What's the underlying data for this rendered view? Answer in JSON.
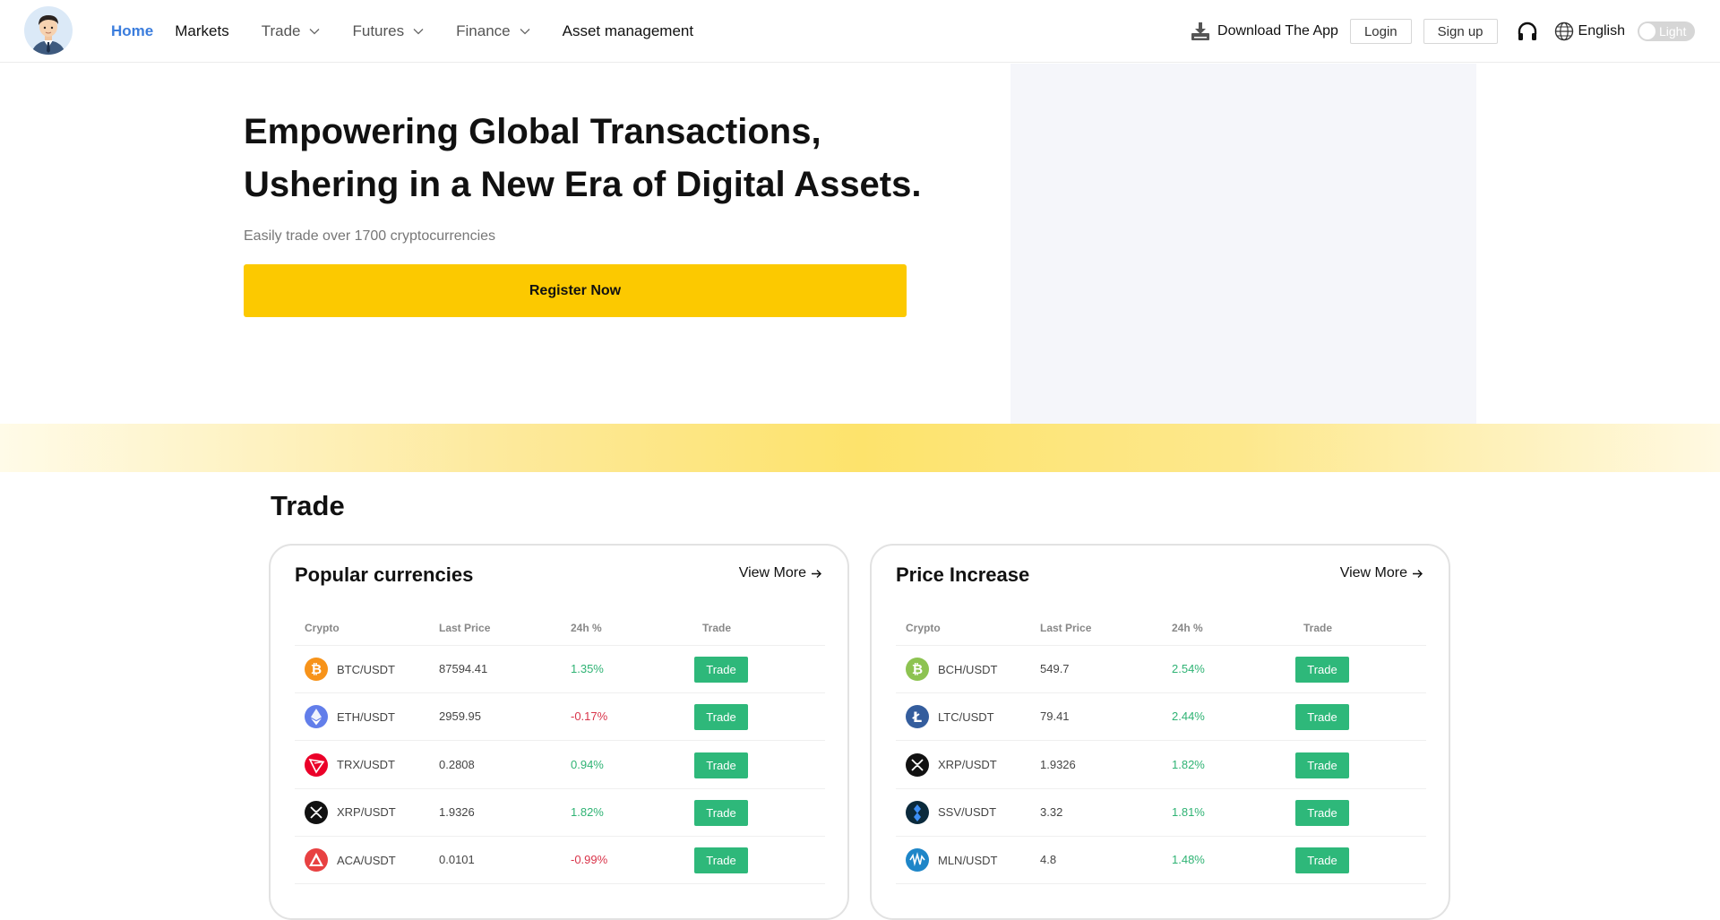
{
  "header": {
    "nav": [
      {
        "label": "Home",
        "dropdown": false,
        "state": "active"
      },
      {
        "label": "Markets",
        "dropdown": false,
        "state": "normal"
      },
      {
        "label": "Trade",
        "dropdown": true,
        "state": "muted"
      },
      {
        "label": "Futures",
        "dropdown": true,
        "state": "muted"
      },
      {
        "label": "Finance",
        "dropdown": true,
        "state": "muted"
      },
      {
        "label": "Asset management",
        "dropdown": false,
        "state": "normal"
      }
    ],
    "download_label": "Download The App",
    "login_label": "Login",
    "signup_label": "Sign up",
    "language": "English",
    "theme_toggle_label": "Light"
  },
  "hero": {
    "title_line1": "Empowering Global Transactions,",
    "title_line2": "Ushering in a New Era of Digital Assets.",
    "subtitle": "Easily trade over 1700 cryptocurrencies",
    "register_label": "Register Now"
  },
  "trade": {
    "section_title": "Trade",
    "columns": [
      "Crypto",
      "Last Price",
      "24h %",
      "Trade"
    ],
    "trade_button_label": "Trade",
    "view_more_label": "View More",
    "popular": {
      "title": "Popular currencies",
      "rows": [
        {
          "pair": "BTC/USDT",
          "price": "87594.41",
          "change": "1.35%",
          "dir": "up",
          "coin": "btc",
          "color": "#f7931a"
        },
        {
          "pair": "ETH/USDT",
          "price": "2959.95",
          "change": "-0.17%",
          "dir": "down",
          "coin": "eth",
          "color": "#627eea"
        },
        {
          "pair": "TRX/USDT",
          "price": "0.2808",
          "change": "0.94%",
          "dir": "up",
          "coin": "trx",
          "color": "#eb0029"
        },
        {
          "pair": "XRP/USDT",
          "price": "1.9326",
          "change": "1.82%",
          "dir": "up",
          "coin": "xrp",
          "color": "#111111"
        },
        {
          "pair": "ACA/USDT",
          "price": "0.0101",
          "change": "-0.99%",
          "dir": "down",
          "coin": "aca",
          "color": "#e84142"
        }
      ]
    },
    "increase": {
      "title": "Price Increase",
      "rows": [
        {
          "pair": "BCH/USDT",
          "price": "549.7",
          "change": "2.54%",
          "dir": "up",
          "coin": "bch",
          "color": "#8dc351"
        },
        {
          "pair": "LTC/USDT",
          "price": "79.41",
          "change": "2.44%",
          "dir": "up",
          "coin": "ltc",
          "color": "#345d9d"
        },
        {
          "pair": "XRP/USDT",
          "price": "1.9326",
          "change": "1.82%",
          "dir": "up",
          "coin": "xrp",
          "color": "#111111"
        },
        {
          "pair": "SSV/USDT",
          "price": "3.32",
          "change": "1.81%",
          "dir": "up",
          "coin": "ssv",
          "color": "#0b2a3c"
        },
        {
          "pair": "MLN/USDT",
          "price": "4.8",
          "change": "1.48%",
          "dir": "up",
          "coin": "mln",
          "color": "#1e86c8"
        }
      ]
    }
  },
  "colors": {
    "accent_blue": "#3b7ddd",
    "register_yellow": "#fcc900",
    "trade_green": "#2eb87a",
    "up_green": "#2fb374",
    "down_red": "#d9344a"
  }
}
